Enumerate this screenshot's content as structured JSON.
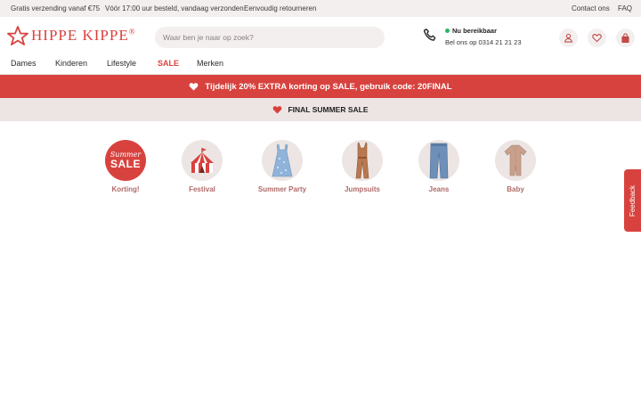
{
  "topbar": {
    "shipping": "Gratis verzending vanaf €75",
    "delivery": "Vóór 17:00 uur besteld, vandaag verzonden",
    "returns": "Eenvoudig retourneren",
    "contact": "Contact ons",
    "faq": "FAQ"
  },
  "header": {
    "logo_text": "HIPPE KIPPE",
    "logo_mark": "®",
    "search_placeholder": "Waar ben je naar op zoek?",
    "status": "Nu bereikbaar",
    "phone": "Bel ons op 0314 21 21 23"
  },
  "nav": [
    "Dames",
    "Kinderen",
    "Lifestyle",
    "SALE",
    "Merken"
  ],
  "promo": "Tijdelijk 20% EXTRA korting op SALE, gebruik code: 20FINAL",
  "sale_banner": "FINAL SUMMER SALE",
  "categories": [
    {
      "label": "Korting!",
      "badge_line1": "Summer",
      "badge_line2": "SALE"
    },
    {
      "label": "Festival"
    },
    {
      "label": "Summer Party"
    },
    {
      "label": "Jumpsuits"
    },
    {
      "label": "Jeans"
    },
    {
      "label": "Baby"
    }
  ],
  "feedback": "Feedback",
  "colors": {
    "brand": "#d8423e",
    "topbar": "#f4efef",
    "category_label": "#b06a6a"
  }
}
